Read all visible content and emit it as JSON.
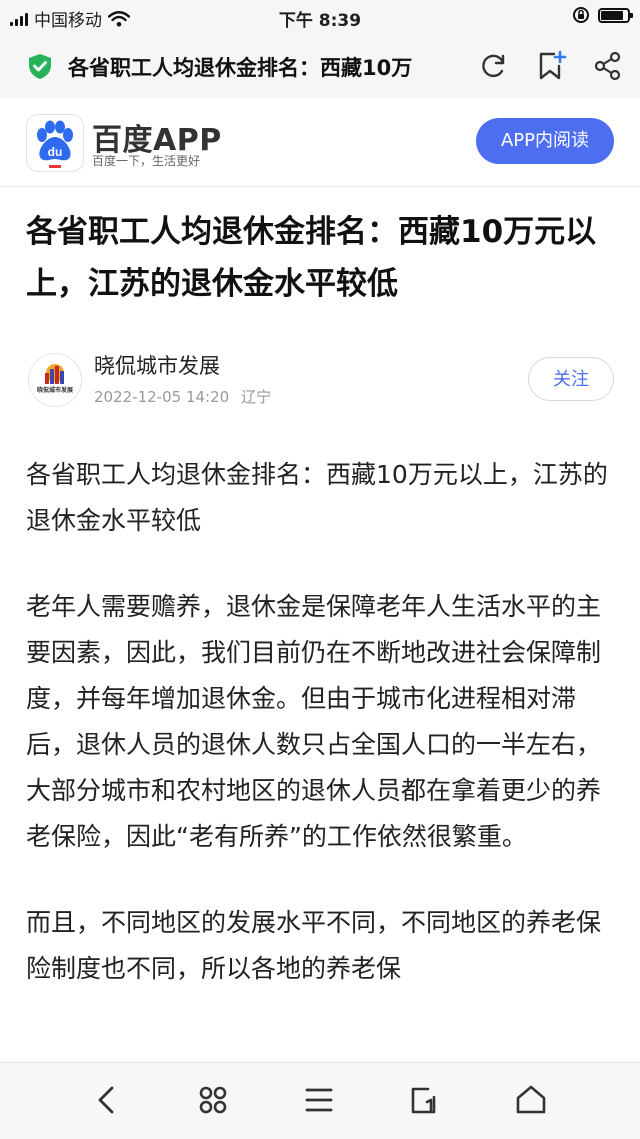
{
  "status_bar": {
    "carrier": "中国移动",
    "time": "下午 8:39"
  },
  "browser": {
    "page_title": "各省职工人均退休金排名：西藏10万",
    "icons": [
      "secure-shield-icon",
      "refresh-icon",
      "bookmark-add-icon",
      "share-icon"
    ]
  },
  "app_banner": {
    "name": "百度APP",
    "slogan": "百度一下，生活更好",
    "logo_text": "du",
    "open_button": "APP内阅读",
    "accent_color": "#4e6ef2"
  },
  "article": {
    "headline": "各省职工人均退休金排名：西藏10万元以上，江苏的退休金水平较低",
    "author": "晓侃城市发展",
    "avatar_text": "晓侃城市发展",
    "published": "2022-12-05 14:20",
    "location": "辽宁",
    "follow_label": "关注",
    "paragraphs": [
      "各省职工人均退休金排名：西藏10万元以上，江苏的退休金水平较低",
      "老年人需要赡养，退休金是保障老年人生活水平的主要因素，因此，我们目前仍在不断地改进社会保障制度，并每年增加退休金。但由于城市化进程相对滞后，退休人员的退休人数只占全国人口的一半左右，大部分城市和农村地区的退休人员都在拿着更少的养老保险，因此“老有所养”的工作依然很繁重。",
      "而且，不同地区的发展水平不同，不同地区的养老保险制度也不同，所以各地的养老保"
    ]
  },
  "bottom_toolbar": {
    "icons": [
      "back-icon",
      "clover-menu-icon",
      "hamburger-menu-icon",
      "tabs-icon",
      "home-icon"
    ]
  }
}
